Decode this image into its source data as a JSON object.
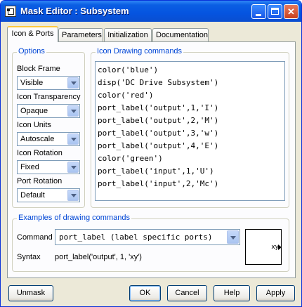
{
  "window": {
    "title": "Mask Editor : Subsystem"
  },
  "tabs": [
    "Icon & Ports",
    "Parameters",
    "Initialization",
    "Documentation"
  ],
  "options": {
    "group_label": "Options",
    "block_frame": {
      "label": "Block Frame",
      "value": "Visible"
    },
    "icon_transparency": {
      "label": "Icon Transparency",
      "value": "Opaque"
    },
    "icon_units": {
      "label": "Icon Units",
      "value": "Autoscale"
    },
    "icon_rotation": {
      "label": "Icon Rotation",
      "value": "Fixed"
    },
    "port_rotation": {
      "label": "Port Rotation",
      "value": "Default"
    }
  },
  "drawing": {
    "group_label": "Icon Drawing commands",
    "lines": [
      "color('blue')",
      "disp('DC Drive Subsystem')",
      "color('red')",
      "port_label('output',1,'I')",
      "port_label('output',2,'M')",
      "port_label('output',3,'w')",
      "port_label('output',4,'E')",
      "color('green')",
      "port_label('input',1,'U')",
      "port_label('input',2,'Mc')"
    ]
  },
  "examples": {
    "group_label": "Examples of drawing commands",
    "command_label": "Command",
    "command_value": "port_label (label specific ports)",
    "syntax_label": "Syntax",
    "syntax_value": "port_label('output', 1, 'xy')",
    "preview_label": "xy"
  },
  "buttons": {
    "unmask": "Unmask",
    "ok": "OK",
    "cancel": "Cancel",
    "help": "Help",
    "apply": "Apply"
  }
}
